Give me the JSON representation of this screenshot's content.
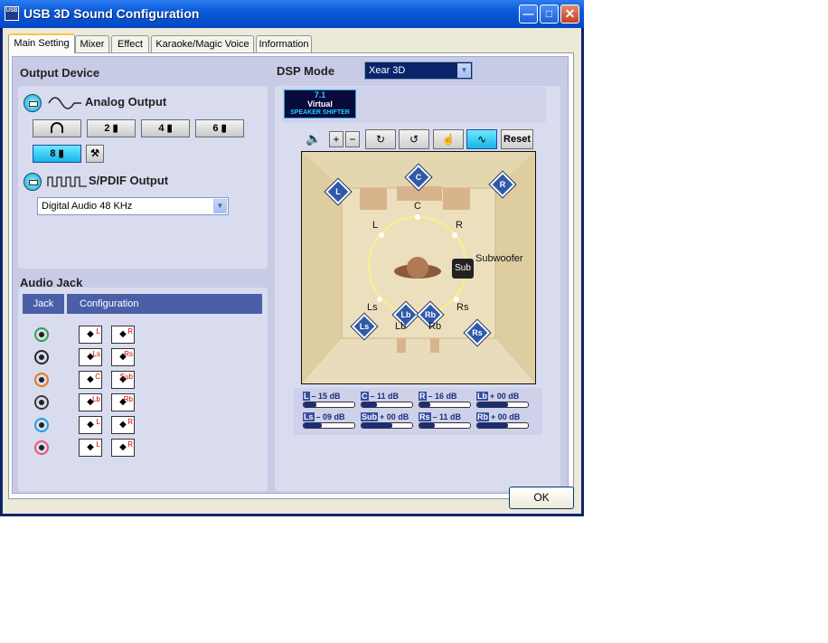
{
  "window": {
    "icon_text": "USB",
    "title": "USB 3D Sound Configuration",
    "minimize_glyph": "—",
    "maximize_glyph": "□",
    "close_glyph": "✕"
  },
  "tabs": [
    "Main Setting",
    "Mixer",
    "Effect",
    "Karaoke/Magic Voice",
    "Information"
  ],
  "output_device": {
    "heading": "Output Device",
    "analog_label": "Analog Output",
    "analog_buttons": [
      "2",
      "4",
      "6"
    ],
    "analog_selected": "8",
    "spdif_label": "S/PDIF Output",
    "spdif_value": "Digital Audio 48 KHz"
  },
  "audio_jack": {
    "heading": "Audio Jack",
    "col_jack": "Jack",
    "col_config": "Configuration",
    "rows": [
      {
        "jack_color": "#2ea24a",
        "a": "L",
        "b": "R"
      },
      {
        "jack_color": "#2a2a2a",
        "a": "Ls",
        "b": "Rs"
      },
      {
        "jack_color": "#e07b1a",
        "a": "C",
        "b": "Sub"
      },
      {
        "jack_color": "#3a3a3a",
        "a": "Lb",
        "b": "Rb"
      },
      {
        "jack_color": "#1e9fe0",
        "a": "L",
        "b": "R"
      },
      {
        "jack_color": "#e8537a",
        "a": "L",
        "b": "R"
      }
    ]
  },
  "dsp": {
    "heading": "DSP Mode",
    "mode_value": "Xear 3D",
    "logo_top": "7.1",
    "logo_mid": "Virtual",
    "logo_bottom": "SPEAKER SHIFTER",
    "reset_label": "Reset"
  },
  "room": {
    "labels": {
      "L": "L",
      "C": "C",
      "R": "R",
      "Ls": "Ls",
      "Lb": "Lb",
      "Rb": "Rb",
      "Rs": "Rs",
      "sub": "Sub",
      "subwoofer": "Subwoofer"
    }
  },
  "volumes": [
    {
      "ch": "L",
      "text": "– 15 dB",
      "level": 0.25
    },
    {
      "ch": "C",
      "text": "– 11 dB",
      "level": 0.3
    },
    {
      "ch": "R",
      "text": "– 16 dB",
      "level": 0.22
    },
    {
      "ch": "Lb",
      "text": "+ 00 dB",
      "level": 0.6
    },
    {
      "ch": "Ls",
      "text": "– 09 dB",
      "level": 0.35
    },
    {
      "ch": "Sub",
      "text": "+ 00 dB",
      "level": 0.6
    },
    {
      "ch": "Rs",
      "text": "– 11 dB",
      "level": 0.3
    },
    {
      "ch": "Rb",
      "text": "+ 00 dB",
      "level": 0.6
    }
  ],
  "ok_label": "OK"
}
